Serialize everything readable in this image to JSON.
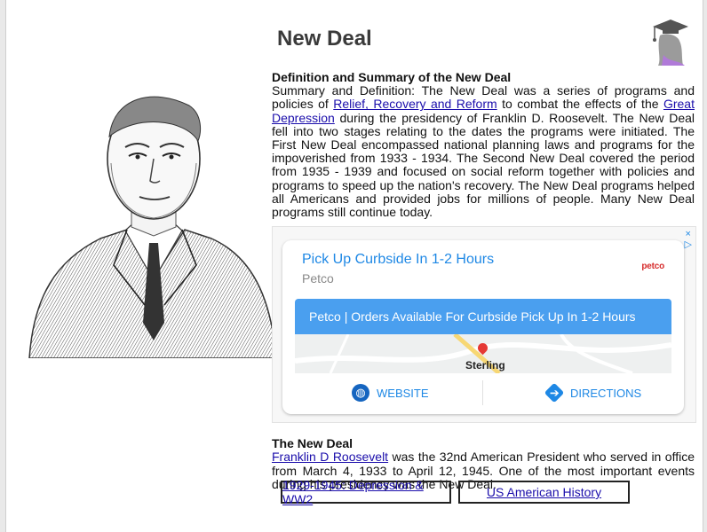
{
  "page_title": "New Deal",
  "section1": {
    "heading": "Definition and Summary of the New Deal",
    "text_before_link1": "Summary and Definition: The New Deal was a series of programs and policies of ",
    "link1": "Relief, Recovery and Reform",
    "text_between": " to combat the effects of the ",
    "link2": "Great Depression",
    "text_after": " during the presidency of Franklin D. Roosevelt. The New Deal fell into two stages relating to the dates the programs were initiated. The First New Deal encompassed national planning laws and programs for the impoverished from 1933 - 1934. The Second New Deal covered the period from 1935 - 1939 and focused on social reform together with policies and programs to speed up the nation's recovery. The New Deal programs helped all Americans and provided jobs for millions of people. Many New Deal programs still continue today."
  },
  "ad": {
    "badge": "x\n▷",
    "title": "Pick Up Curbside In 1-2 Hours",
    "subtitle": "Petco",
    "brand": "petco",
    "bar_text": "Petco | Orders Available For Curbside Pick Up In 1-2 Hours",
    "map_label": "Sterling",
    "website_label": "WEBSITE",
    "directions_label": "DIRECTIONS",
    "icons": [
      "globe-icon",
      "directions-icon",
      "map-pin-icon"
    ]
  },
  "section2": {
    "heading": "The New Deal",
    "link": "Franklin D Roosevelt",
    "text": " was the 32nd American President who served in office from March 4, 1933 to April 12, 1945. One of the most important events during his presidency was the New Deal."
  },
  "links": [
    "1929-1945: Depression & WW2",
    "US American History"
  ],
  "colors": {
    "link": "#1a0dab",
    "ad_accent": "#1e88e5",
    "ad_bar": "#4a9fef",
    "logo_purple": "#b07ad8"
  }
}
